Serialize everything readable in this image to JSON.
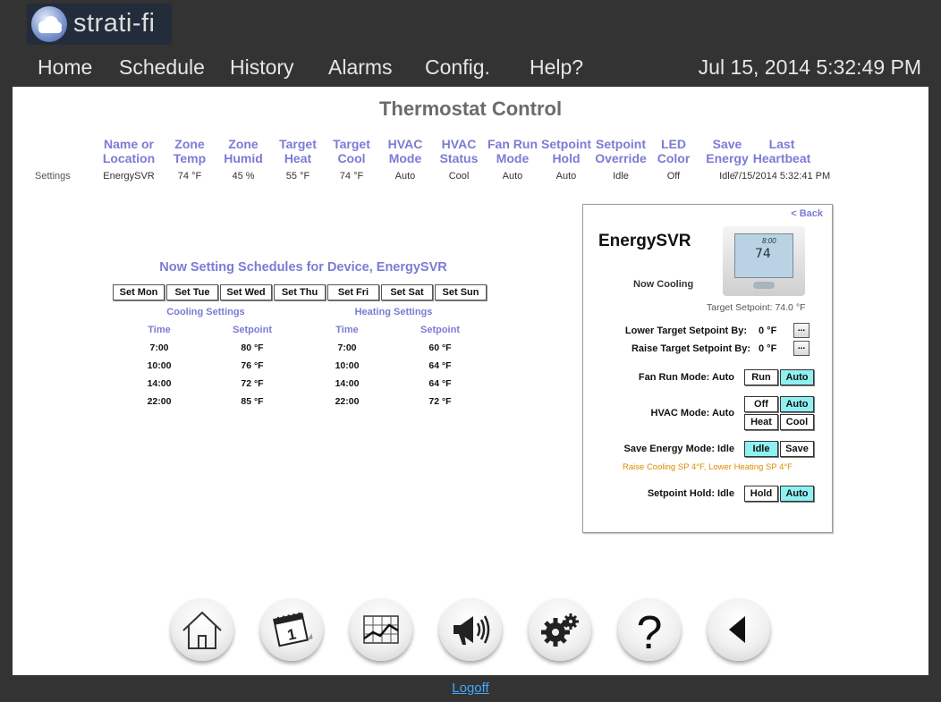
{
  "app": {
    "logo_text": "strati-fi"
  },
  "nav": {
    "items": [
      "Home",
      "Schedule",
      "History",
      "Alarms",
      "Config.",
      "Help?"
    ],
    "datetime": "Jul 15, 2014 5:32:49 PM"
  },
  "page": {
    "title": "Thermostat Control"
  },
  "status_table": {
    "row_label": "Settings",
    "columns": [
      {
        "h1": "Name or",
        "h2": "Location",
        "value": "EnergySVR"
      },
      {
        "h1": "Zone",
        "h2": "Temp",
        "value": "74 °F"
      },
      {
        "h1": "Zone",
        "h2": "Humid",
        "value": "45 %"
      },
      {
        "h1": "Target",
        "h2": "Heat",
        "value": "55 °F"
      },
      {
        "h1": "Target",
        "h2": "Cool",
        "value": "74 °F"
      },
      {
        "h1": "HVAC",
        "h2": "Mode",
        "value": "Auto"
      },
      {
        "h1": "HVAC",
        "h2": "Status",
        "value": "Cool"
      },
      {
        "h1": "Fan Run",
        "h2": "Mode",
        "value": "Auto"
      },
      {
        "h1": "Setpoint",
        "h2": "Hold",
        "value": "Auto"
      },
      {
        "h1": "Setpoint",
        "h2": "Override",
        "value": "Idle"
      },
      {
        "h1": "LED",
        "h2": "Color",
        "value": "Off"
      },
      {
        "h1": "Save",
        "h2": "Energy",
        "value": "Idle"
      },
      {
        "h1": "Last",
        "h2": "Heartbeat",
        "value": "7/15/2014 5:32:41 PM"
      }
    ]
  },
  "schedule": {
    "title": "Now Setting Schedules for Device, EnergySVR",
    "days": [
      "Set Mon",
      "Set Tue",
      "Set Wed",
      "Set Thu",
      "Set Fri",
      "Set Sat",
      "Set Sun"
    ],
    "cooling": {
      "label": "Cooling Settings",
      "time_header": "Time",
      "setpoint_header": "Setpoint",
      "rows": [
        {
          "time": "7:00",
          "setpoint": "80 °F"
        },
        {
          "time": "10:00",
          "setpoint": "76 °F"
        },
        {
          "time": "14:00",
          "setpoint": "72 °F"
        },
        {
          "time": "22:00",
          "setpoint": "85 °F"
        }
      ]
    },
    "heating": {
      "label": "Heating Settings",
      "time_header": "Time",
      "setpoint_header": "Setpoint",
      "rows": [
        {
          "time": "7:00",
          "setpoint": "60 °F"
        },
        {
          "time": "10:00",
          "setpoint": "64 °F"
        },
        {
          "time": "14:00",
          "setpoint": "64 °F"
        },
        {
          "time": "22:00",
          "setpoint": "72 °F"
        }
      ]
    }
  },
  "device": {
    "back_label": "< Back",
    "name": "EnergySVR",
    "status": "Now Cooling",
    "thermostat_display": {
      "temp": "74",
      "time": "8:00"
    },
    "target_setpoint": "Target Setpoint: 74.0 °F",
    "lower_label": "Lower Target Setpoint By:",
    "lower_value": "0 °F",
    "raise_label": "Raise Target Setpoint By:",
    "raise_value": "0 °F",
    "dots": "...",
    "fan_label": "Fan Run Mode: Auto",
    "fan_buttons": [
      "Run",
      "Auto"
    ],
    "hvac_label": "HVAC Mode: Auto",
    "hvac_buttons": [
      "Off",
      "Auto",
      "Heat",
      "Cool"
    ],
    "save_label": "Save Energy Mode: Idle",
    "save_buttons": [
      "Idle",
      "Save"
    ],
    "save_note": "Raise Cooling SP 4°F, Lower Heating SP 4°F",
    "hold_label": "Setpoint Hold: Idle",
    "hold_buttons": [
      "Hold",
      "Auto"
    ],
    "active_color": "#8ff0f2"
  },
  "bottom_icons": [
    "home-icon",
    "calendar-icon",
    "chart-icon",
    "megaphone-icon",
    "gears-icon",
    "help-icon",
    "back-icon"
  ],
  "footer": {
    "logoff": "Logoff"
  },
  "colors": {
    "accent": "#7b7bd6",
    "background": "#333333",
    "link": "#3fa9ff",
    "note": "#e08a00"
  }
}
